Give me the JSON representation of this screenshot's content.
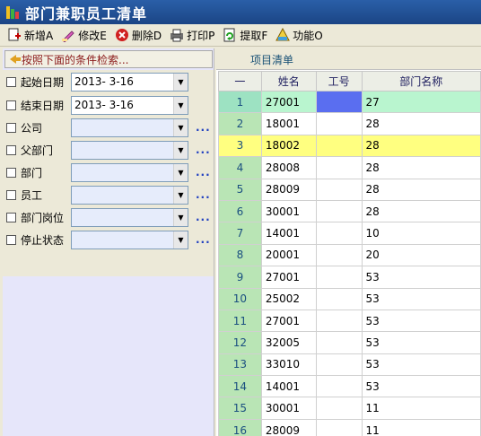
{
  "window": {
    "title": "部门兼职员工清单"
  },
  "toolbar": [
    {
      "label": "新增A",
      "icon": "add-icon"
    },
    {
      "label": "修改E",
      "icon": "edit-icon"
    },
    {
      "label": "删除D",
      "icon": "delete-icon"
    },
    {
      "label": "打印P",
      "icon": "printer-icon"
    },
    {
      "label": "提取F",
      "icon": "extract-icon"
    },
    {
      "label": "功能O",
      "icon": "function-icon"
    }
  ],
  "search": {
    "label": "按照下面的条件检索..."
  },
  "filters": [
    {
      "label": "起始日期",
      "value": "2013-  3-16"
    },
    {
      "label": "结束日期",
      "value": "2013-  3-16"
    },
    {
      "label": "公司",
      "value": ""
    },
    {
      "label": "父部门",
      "value": ""
    },
    {
      "label": "部门",
      "value": ""
    },
    {
      "label": "员工",
      "value": ""
    },
    {
      "label": "部门岗位",
      "value": ""
    },
    {
      "label": "停止状态",
      "value": ""
    }
  ],
  "ellipsis": "...",
  "grid": {
    "title": "项目清单",
    "columns": [
      "一",
      "姓名",
      "工号",
      "部门名称"
    ],
    "rows": [
      [
        "1",
        "27001",
        "",
        "27"
      ],
      [
        "2",
        "18001",
        "",
        "28"
      ],
      [
        "3",
        "18002",
        "",
        "28"
      ],
      [
        "4",
        "28008",
        "",
        "28"
      ],
      [
        "5",
        "28009",
        "",
        "28"
      ],
      [
        "6",
        "30001",
        "",
        "28"
      ],
      [
        "7",
        "14001",
        "",
        "10"
      ],
      [
        "8",
        "20001",
        "",
        "20"
      ],
      [
        "9",
        "27001",
        "",
        "53"
      ],
      [
        "10",
        "25002",
        "",
        "53"
      ],
      [
        "11",
        "27001",
        "",
        "53"
      ],
      [
        "12",
        "32005",
        "",
        "53"
      ],
      [
        "13",
        "33010",
        "",
        "53"
      ],
      [
        "14",
        "14001",
        "",
        "53"
      ],
      [
        "15",
        "30001",
        "",
        "11"
      ],
      [
        "16",
        "28009",
        "",
        "11"
      ]
    ]
  }
}
